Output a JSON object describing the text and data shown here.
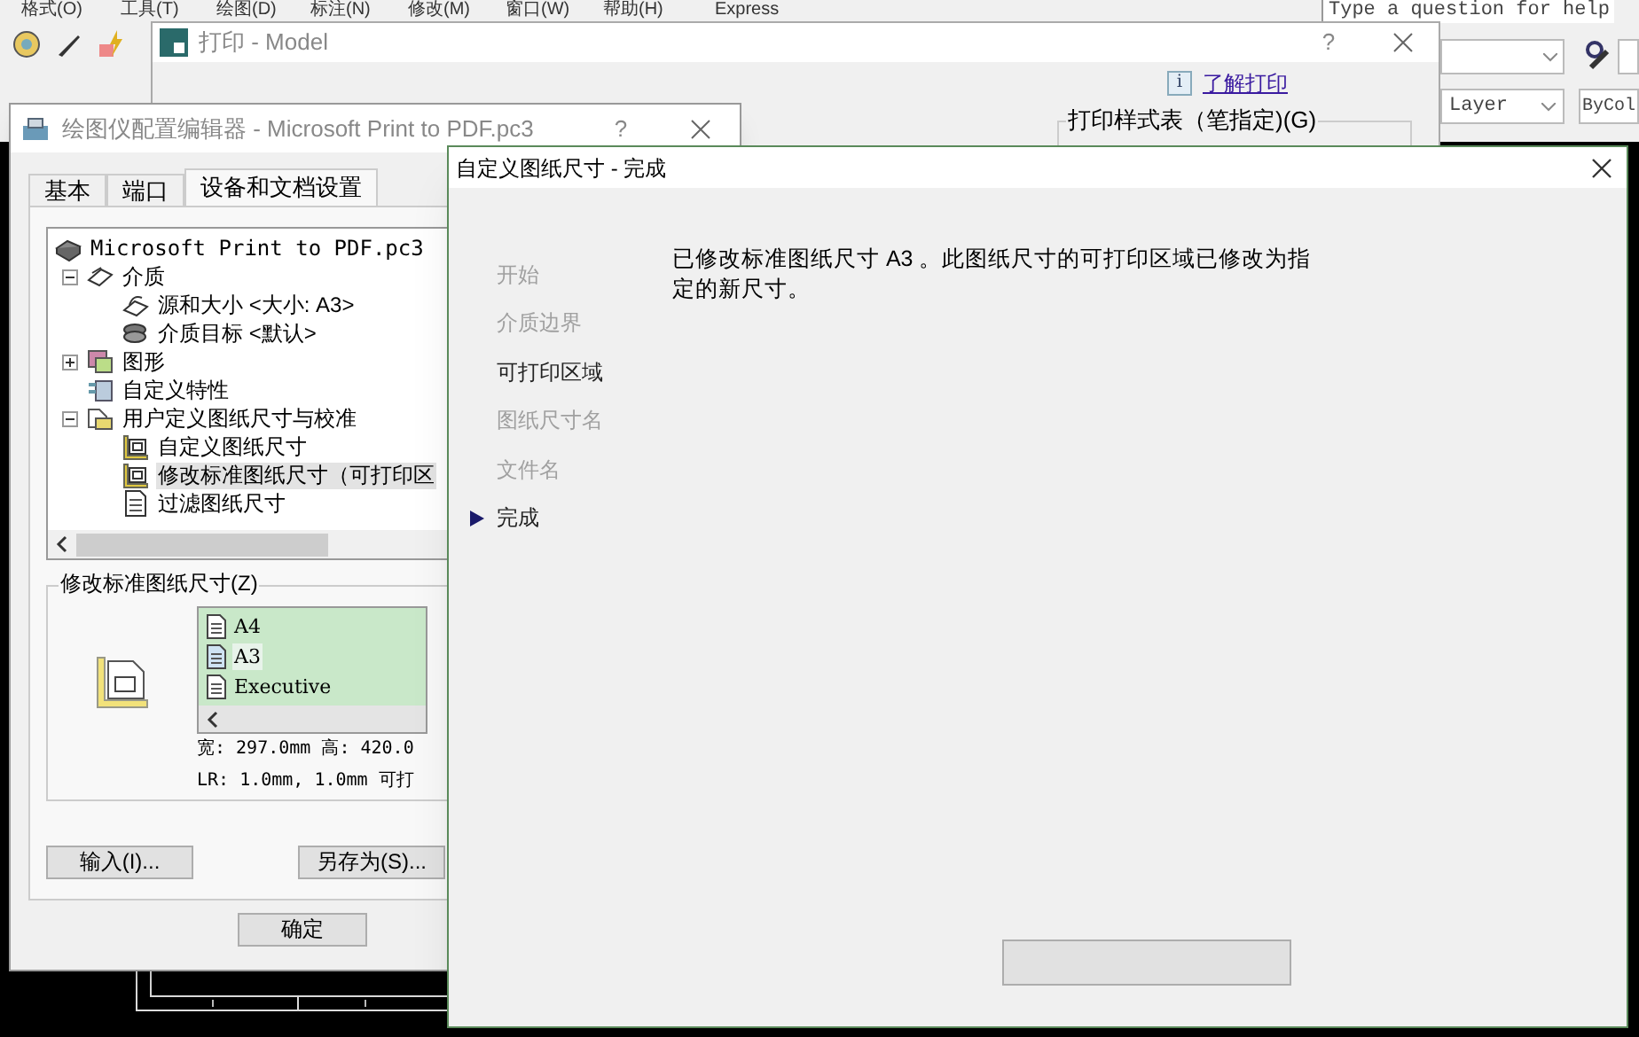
{
  "menu_bar": {
    "items": [
      "格式(O)",
      "工具(T)",
      "绘图(D)",
      "标注(N)",
      "修改(M)",
      "窗口(W)",
      "帮助(H)",
      "Express"
    ]
  },
  "help_search": {
    "placeholder": "Type a question for help"
  },
  "toolbar": {
    "layer_dropdown": "Layer",
    "color_dropdown": "ByCol"
  },
  "print_dialog": {
    "title": "打印 - Model",
    "help": "?",
    "info_badge": "i",
    "help_link": "了解打印",
    "plot_style_group": "打印样式表（笔指定)(G)"
  },
  "plotter_editor": {
    "title": "绘图仪配置编辑器 - Microsoft Print to PDF.pc3",
    "help": "?",
    "tabs": [
      {
        "label": "基本",
        "selected": false
      },
      {
        "label": "端口",
        "selected": false
      },
      {
        "label": "设备和文档设置",
        "selected": true
      }
    ],
    "tree": [
      {
        "label": "Microsoft Print to PDF.pc3",
        "kind": "printer",
        "selected": false,
        "children": [
          {
            "label": "介质",
            "kind": "media",
            "expanded": true,
            "selected": false,
            "children": [
              {
                "label": "源和大小 <大小: A3>",
                "kind": "tray",
                "selected": false
              },
              {
                "label": "介质目标 <默认>",
                "kind": "stack",
                "selected": false
              }
            ]
          },
          {
            "label": "图形",
            "kind": "graphics",
            "expanded": false,
            "selected": false
          },
          {
            "label": "自定义特性",
            "kind": "properties",
            "selected": false
          },
          {
            "label": "用户定义图纸尺寸与校准",
            "kind": "calibration",
            "expanded": true,
            "selected": false,
            "children": [
              {
                "label": "自定义图纸尺寸",
                "kind": "paper",
                "selected": false
              },
              {
                "label": "修改标准图纸尺寸（可打印区",
                "kind": "paper",
                "selected": true
              },
              {
                "label": "过滤图纸尺寸",
                "kind": "page",
                "selected": false
              }
            ]
          }
        ]
      }
    ],
    "paper_group": {
      "label": "修改标准图纸尺寸(Z)",
      "sizes": [
        {
          "label": "A4",
          "selected": false
        },
        {
          "label": "A3",
          "selected": true
        },
        {
          "label": "Executive",
          "selected": false
        }
      ],
      "dimensions": "宽: 297.0mm 高: 420.0",
      "margins": "LR: 1.0mm, 1.0mm  可打"
    },
    "buttons": [
      "输入(I)...",
      "另存为(S)..."
    ],
    "footer_buttons": [
      "确定"
    ]
  },
  "wizard": {
    "title": "自定义图纸尺寸 - 完成",
    "steps": [
      {
        "label": "开始",
        "dimmed": true,
        "current": false
      },
      {
        "label": "介质边界",
        "dimmed": true,
        "current": false
      },
      {
        "label": "可打印区域",
        "dimmed": false,
        "current": false
      },
      {
        "label": "图纸尺寸名",
        "dimmed": true,
        "current": false
      },
      {
        "label": "文件名",
        "dimmed": true,
        "current": false
      },
      {
        "label": "完成",
        "dimmed": false,
        "current": true
      }
    ],
    "message": "已修改标准图纸尺寸 A3 。此图纸尺寸的可打印区域已修改为指定的新尺寸。"
  }
}
